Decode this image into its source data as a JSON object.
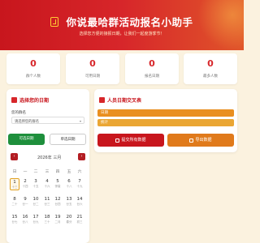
{
  "header": {
    "title": "你说最哈群活动报名小助手",
    "subtitle": "选择您方便的接报日期，让我们一起度游季节！"
  },
  "stats": [
    {
      "value": "0",
      "label": "群个人数"
    },
    {
      "value": "0",
      "label": "可用日期"
    },
    {
      "value": "0",
      "label": "报名日期"
    },
    {
      "value": "0",
      "label": "最多人数"
    }
  ],
  "left_panel": {
    "title": "选择您的日期",
    "field_label": "您的群名",
    "select_value": "请选择您的群名",
    "btn_multi": "可选日期",
    "btn_single": "单选日期",
    "month": "2026年 三月",
    "prev": "‹",
    "next": "›",
    "weekdays": [
      "日",
      "一",
      "二",
      "三",
      "四",
      "五",
      "六"
    ],
    "days": [
      {
        "n": "1",
        "l": "十三"
      },
      {
        "n": "2",
        "l": "十四"
      },
      {
        "n": "3",
        "l": "十五"
      },
      {
        "n": "4",
        "l": "十六"
      },
      {
        "n": "5",
        "l": "惊蛰"
      },
      {
        "n": "6",
        "l": "十八"
      },
      {
        "n": "7",
        "l": "十九"
      },
      {
        "n": "8",
        "l": "二十"
      },
      {
        "n": "9",
        "l": "廿一"
      },
      {
        "n": "10",
        "l": "廿二"
      },
      {
        "n": "11",
        "l": "廿三"
      },
      {
        "n": "12",
        "l": "廿四"
      },
      {
        "n": "13",
        "l": "廿五"
      },
      {
        "n": "14",
        "l": "廿六"
      },
      {
        "n": "15",
        "l": "廿七"
      },
      {
        "n": "16",
        "l": "廿八"
      },
      {
        "n": "17",
        "l": "廿九"
      },
      {
        "n": "18",
        "l": "三十"
      },
      {
        "n": "19",
        "l": "二月"
      },
      {
        "n": "20",
        "l": "春分"
      },
      {
        "n": "21",
        "l": "初三"
      }
    ]
  },
  "right_panel": {
    "title": "人员日期交叉表",
    "bar1": "日期",
    "bar2": "统计",
    "btn_save": "提交所有数据",
    "btn_export": "导出数据"
  },
  "colors": {
    "primary": "#d7262a",
    "green": "#1e8f3c",
    "orange": "#e07a1b"
  }
}
